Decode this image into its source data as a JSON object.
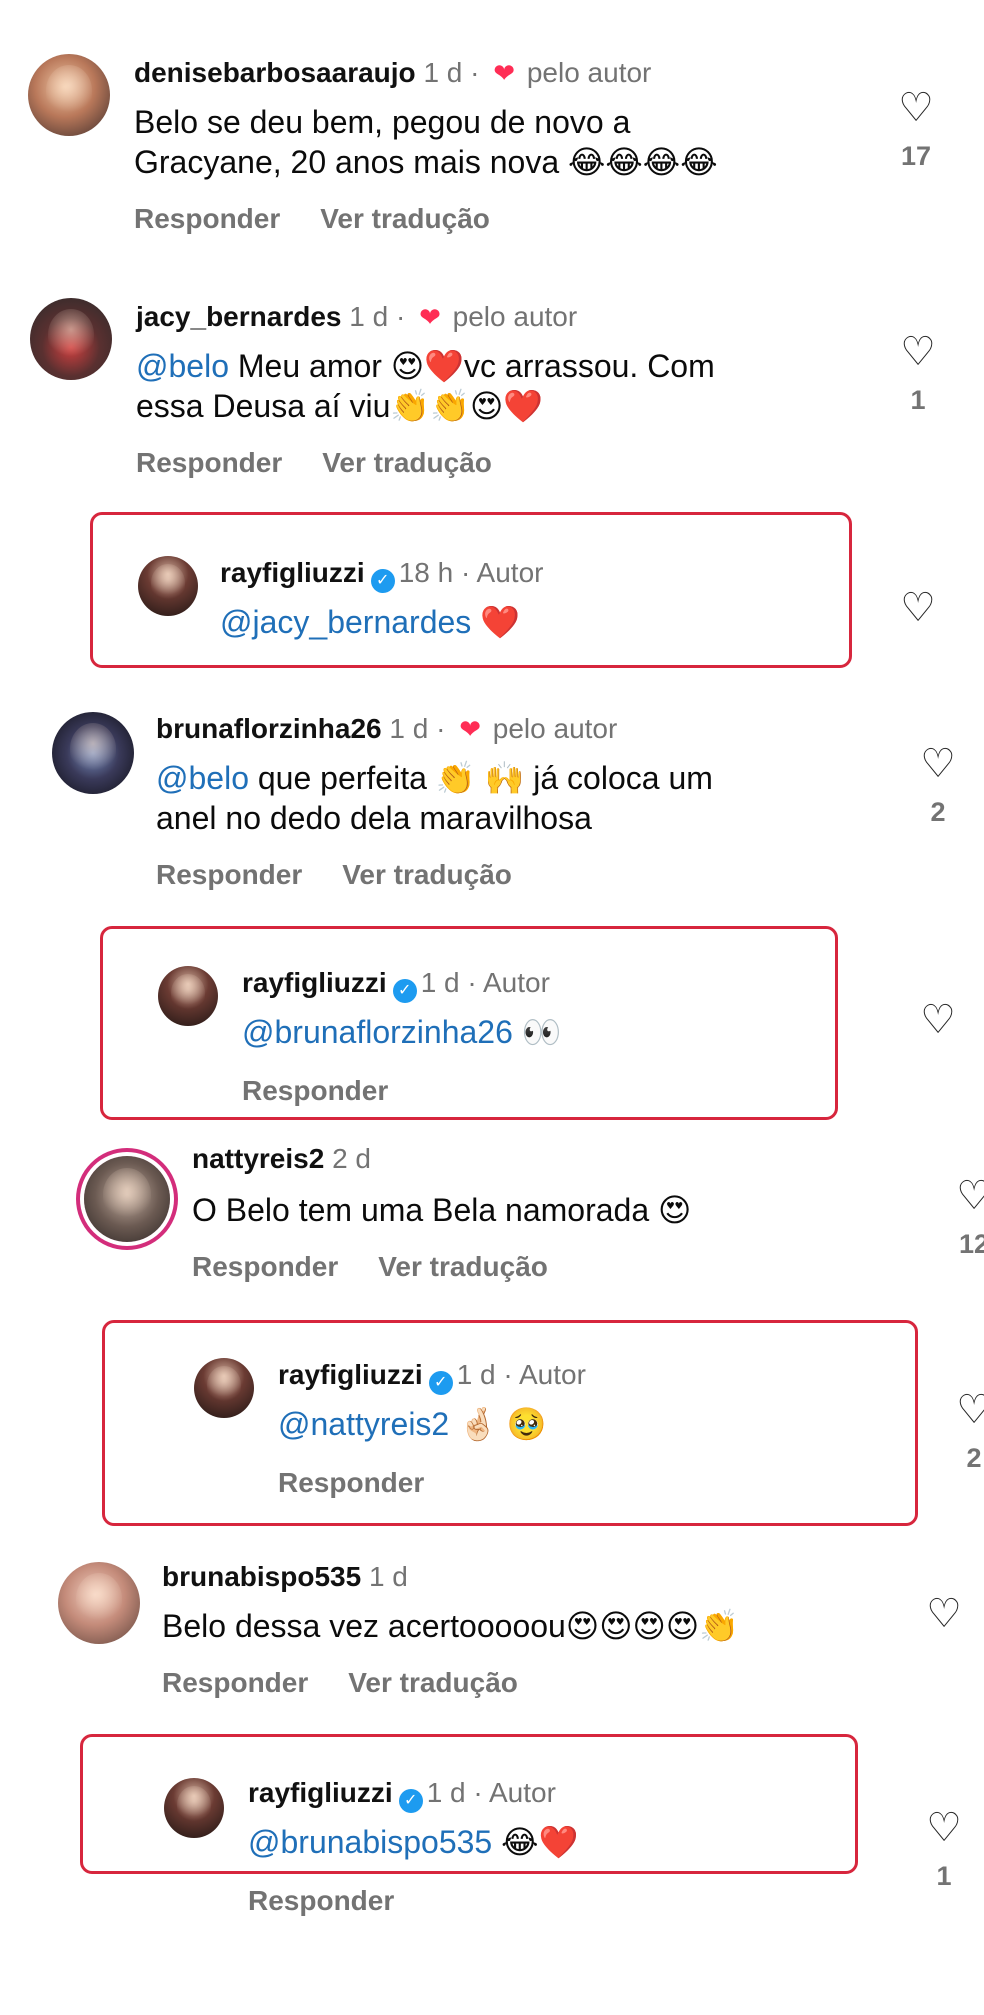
{
  "comments": [
    {
      "username": "denisebarbosaaraujo",
      "time": "1 d",
      "liked_by_author": "pelo autor",
      "line1": "Belo se deu bem, pegou de novo a",
      "line2": "Gracyane, 20 anos mais nova 😂😂😂😂",
      "reply": "Responder",
      "translate": "Ver tradução",
      "likes": "17"
    },
    {
      "username": "jacy_bernardes",
      "time": "1 d",
      "liked_by_author": "pelo autor",
      "mention": "@belo",
      "line1": " Meu amor 😍❤️vc arrassou. Com",
      "line2": "essa Deusa aí viu👏👏😍❤️",
      "reply": "Responder",
      "translate": "Ver tradução",
      "likes": "1"
    },
    {
      "username": "rayfigliuzzi",
      "time": "18 h",
      "author": "Autor",
      "mention": "@jacy_bernardes",
      "text": " ❤️"
    },
    {
      "username": "brunaflorzinha26",
      "time": "1 d",
      "liked_by_author": "pelo autor",
      "mention": "@belo",
      "line1": "  que perfeita 👏 🙌 já coloca um",
      "line2": "anel no dedo dela maravilhosa",
      "reply": "Responder",
      "translate": "Ver tradução",
      "likes": "2"
    },
    {
      "username": "rayfigliuzzi",
      "time": "1 d",
      "author": "Autor",
      "mention": "@brunaflorzinha26",
      "text": " 👀",
      "reply": "Responder"
    },
    {
      "username": "nattyreis2",
      "time": "2 d",
      "line1": "O Belo tem uma Bela namorada 😍",
      "reply": "Responder",
      "translate": "Ver tradução",
      "likes": "12"
    },
    {
      "username": "rayfigliuzzi",
      "time": "1 d",
      "author": "Autor",
      "mention": "@nattyreis2",
      "text": " 🤞🏻 🥹",
      "reply": "Responder",
      "likes": "2"
    },
    {
      "username": "brunabispo535",
      "time": "1 d",
      "line1": "Belo dessa vez acertooooou😍😍😍😍👏",
      "reply": "Responder",
      "translate": "Ver tradução"
    },
    {
      "username": "rayfigliuzzi",
      "time": "1 d",
      "author": "Autor",
      "mention": "@brunabispo535",
      "text": " 😂❤️",
      "reply": "Responder",
      "likes": "1"
    }
  ],
  "colors": {
    "highlight_border": "#d7263d",
    "mention": "#1f6fb8",
    "meta": "#737373",
    "verified": "#1d9bf0",
    "liked_heart": "#ff2d55"
  },
  "icons": {
    "like": "heart-outline-icon",
    "liked_by_author": "heart-filled-icon",
    "verified": "verified-badge-icon"
  }
}
